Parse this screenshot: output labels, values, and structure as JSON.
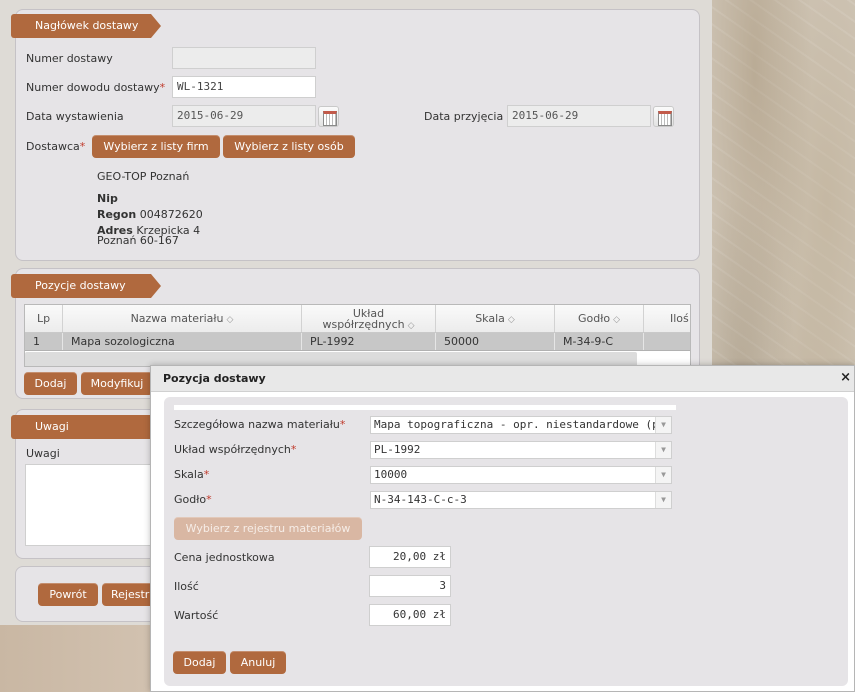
{
  "header_panel": {
    "title": "Nagłówek dostawy",
    "numer_dostawy_label": "Numer dostawy",
    "numer_dostawy_value": "",
    "numer_dowodu_label": "Numer dowodu dostawy",
    "numer_dowodu_value": "WL-1321",
    "data_wystawienia_label": "Data wystawienia",
    "data_wystawienia_value": "2015-06-29",
    "data_przyjecia_label": "Data przyjęcia",
    "data_przyjecia_value": "2015-06-29",
    "dostawca_label": "Dostawca",
    "btn_firm": "Wybierz z listy firm",
    "btn_osob": "Wybierz z listy osób",
    "supplier_name": "GEO-TOP Poznań",
    "nip_label": "Nip",
    "regon_label": "Regon",
    "regon_value": "004872620",
    "adres_label": "Adres",
    "adres_line1": "Krzepicka 4",
    "adres_line2": "Poznań 60-167",
    "required_mark": "*"
  },
  "positions_panel": {
    "title": "Pozycje dostawy",
    "columns": {
      "lp": "Lp",
      "nazwa": "Nazwa materiału",
      "uklad_line1": "Układ",
      "uklad_line2": "współrzędnych",
      "skala": "Skala",
      "godlo": "Godło",
      "ilosc": "Iloś"
    },
    "sort_glyph": "◇",
    "rows": [
      {
        "lp": "1",
        "nazwa": "Mapa sozologiczna",
        "uklad": "PL-1992",
        "skala": "50000",
        "godlo": "M-34-9-C",
        "ilosc": ""
      }
    ],
    "btn_dodaj": "Dodaj",
    "btn_modyfikuj": "Modyfikuj"
  },
  "uwagi_panel": {
    "title": "Uwagi",
    "label": "Uwagi"
  },
  "footer_panel": {
    "btn_powrot": "Powrót",
    "btn_rejestruj": "Rejestruj"
  },
  "dialog": {
    "title": "Pozycja dostawy",
    "close_glyph": "×",
    "szczegolowa_label": "Szczegółowa nazwa materiału",
    "szczegolowa_value": "Mapa topograficzna - opr. niestandardowe (płaska)",
    "uklad_label": "Układ współrzędnych",
    "uklad_value": "PL-1992",
    "skala_label": "Skala",
    "skala_value": "10000",
    "godlo_label": "Godło",
    "godlo_value": "N-34-143-C-c-3",
    "btn_rejestr": "Wybierz z rejestru materiałów",
    "cena_label": "Cena jednostkowa",
    "cena_value": "20,00 zł",
    "ilosc_label": "Ilość",
    "ilosc_value": "3",
    "wartosc_label": "Wartość",
    "wartosc_value": "60,00 zł",
    "btn_dodaj": "Dodaj",
    "btn_anuluj": "Anuluj",
    "dropdown_glyph": "▼"
  },
  "colors": {
    "accent": "#b0693e",
    "required": "#c0392b",
    "panel": "#e6e4e7"
  }
}
